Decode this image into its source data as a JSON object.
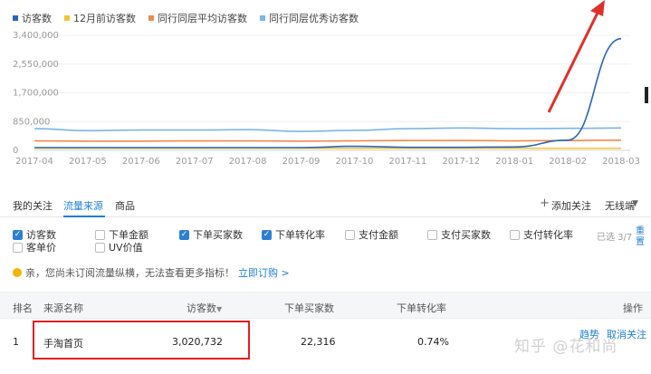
{
  "chart_data": {
    "type": "line",
    "x": [
      "2017-04",
      "2017-05",
      "2017-06",
      "2017-07",
      "2017-08",
      "2017-09",
      "2017-10",
      "2017-11",
      "2017-12",
      "2018-01",
      "2018-02",
      "2018-03"
    ],
    "yticks": [
      "3,400,000",
      "2,550,000",
      "1,700,000",
      "850,000",
      "0"
    ],
    "ylim": [
      0,
      3400000
    ],
    "grid": true,
    "legend_position": "top-left",
    "series": [
      {
        "name": "访客数",
        "color": "#2b66b8",
        "values": [
          80000,
          80000,
          80000,
          80000,
          80000,
          80000,
          120000,
          90000,
          90000,
          100000,
          300000,
          3300000
        ]
      },
      {
        "name": "12月前访客数",
        "color": "#f4c431",
        "values": [
          60000,
          60000,
          60000,
          60000,
          60000,
          60000,
          60000,
          60000,
          60000,
          60000,
          60000,
          60000
        ]
      },
      {
        "name": "同行同层平均访客数",
        "color": "#ef8a4c",
        "values": [
          280000,
          270000,
          270000,
          280000,
          280000,
          270000,
          280000,
          290000,
          290000,
          280000,
          290000,
          300000
        ]
      },
      {
        "name": "同行同层优秀访客数",
        "color": "#79b6ea",
        "values": [
          640000,
          580000,
          600000,
          600000,
          610000,
          560000,
          590000,
          640000,
          660000,
          640000,
          650000,
          660000
        ]
      }
    ]
  },
  "tabs": {
    "items": [
      "我的关注",
      "流量来源",
      "商品"
    ],
    "active": "流量来源",
    "add_follow": "添加关注",
    "wireless": "无线端"
  },
  "metrics": [
    {
      "label": "访客数",
      "checked": true
    },
    {
      "label": "下单金额",
      "checked": false
    },
    {
      "label": "下单买家数",
      "checked": true
    },
    {
      "label": "下单转化率",
      "checked": true
    },
    {
      "label": "支付金额",
      "checked": false
    },
    {
      "label": "支付买家数",
      "checked": false
    },
    {
      "label": "支付转化率",
      "checked": false
    },
    {
      "label": "客单价",
      "checked": false
    },
    {
      "label": "UV价值",
      "checked": false
    }
  ],
  "selected_count": "已选 3/7",
  "reset": "重置",
  "notice": {
    "text": "亲，您尚未订阅流量纵横，无法查看更多指标！",
    "link": "立即订购 >"
  },
  "table": {
    "headers": [
      "排名",
      "来源名称",
      "访客数",
      "下单买家数",
      "下单转化率",
      "操作"
    ],
    "rows": [
      {
        "rank": "1",
        "source": "手淘首页",
        "visitors": "3,020,732",
        "buyers": "22,316",
        "conversion": "0.74%",
        "actions": [
          "趋势",
          "取消关注"
        ]
      }
    ]
  },
  "watermark": "知乎 @花和尚"
}
